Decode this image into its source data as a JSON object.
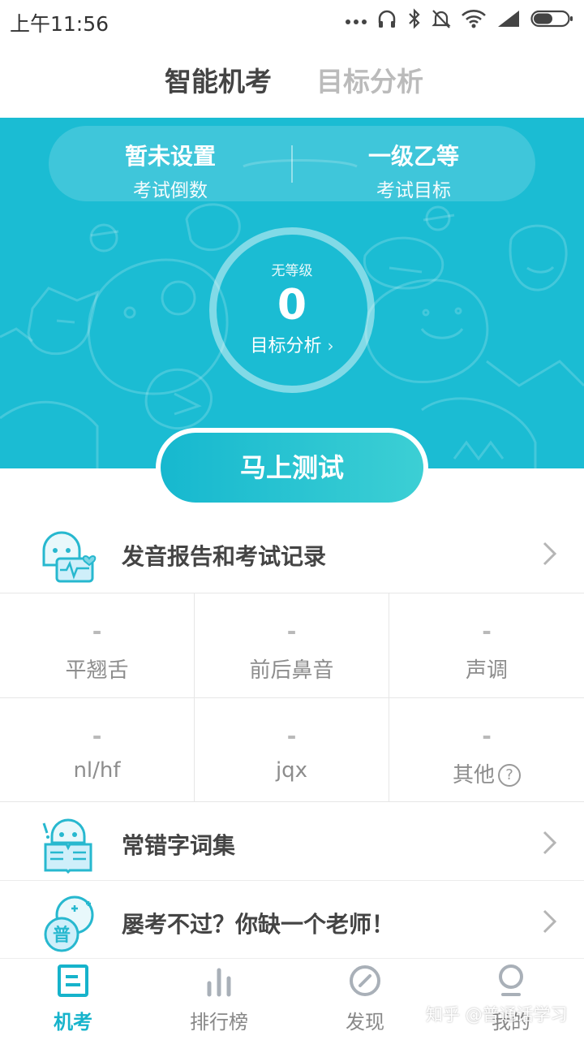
{
  "status_bar": {
    "time": "上午11:56"
  },
  "top_tabs": [
    {
      "label": "智能机考",
      "active": true
    },
    {
      "label": "目标分析",
      "active": false
    }
  ],
  "hero": {
    "countdown": {
      "value": "暂未设置",
      "label": "考试倒数"
    },
    "target": {
      "value": "一级乙等",
      "label": "考试目标"
    },
    "score": {
      "level": "无等级",
      "value": "0",
      "link": "目标分析",
      "link_icon": "chevron-right-icon"
    },
    "test_button": "马上测试",
    "background_color": "#1bbcd3"
  },
  "report_row": {
    "title": "发音报告和考试记录",
    "icon": "robot-heartbeat-icon"
  },
  "stats": [
    {
      "value": "-",
      "label": "平翘舌"
    },
    {
      "value": "-",
      "label": "前后鼻音"
    },
    {
      "value": "-",
      "label": "声调"
    },
    {
      "value": "-",
      "label": "nl/hf"
    },
    {
      "value": "-",
      "label": "jqx"
    },
    {
      "value": "-",
      "label": "其他",
      "help_icon": "?"
    }
  ],
  "mistakes_row": {
    "title": "常错字词集",
    "icon": "robot-book-icon"
  },
  "teacher_row": {
    "title": "屡考不过？你缺一个老师！",
    "icon": "pu-badge-icon"
  },
  "bottom_nav": [
    {
      "label": "机考",
      "icon": "exam-icon",
      "active": true
    },
    {
      "label": "排行榜",
      "icon": "bar-chart-icon",
      "active": false
    },
    {
      "label": "发现",
      "icon": "compass-icon",
      "active": false
    },
    {
      "label": "我的",
      "icon": "profile-icon",
      "active": false
    }
  ],
  "watermark": "知乎 @普通话学习",
  "colors": {
    "accent": "#16b3cb",
    "hero": "#1bbcd3"
  }
}
